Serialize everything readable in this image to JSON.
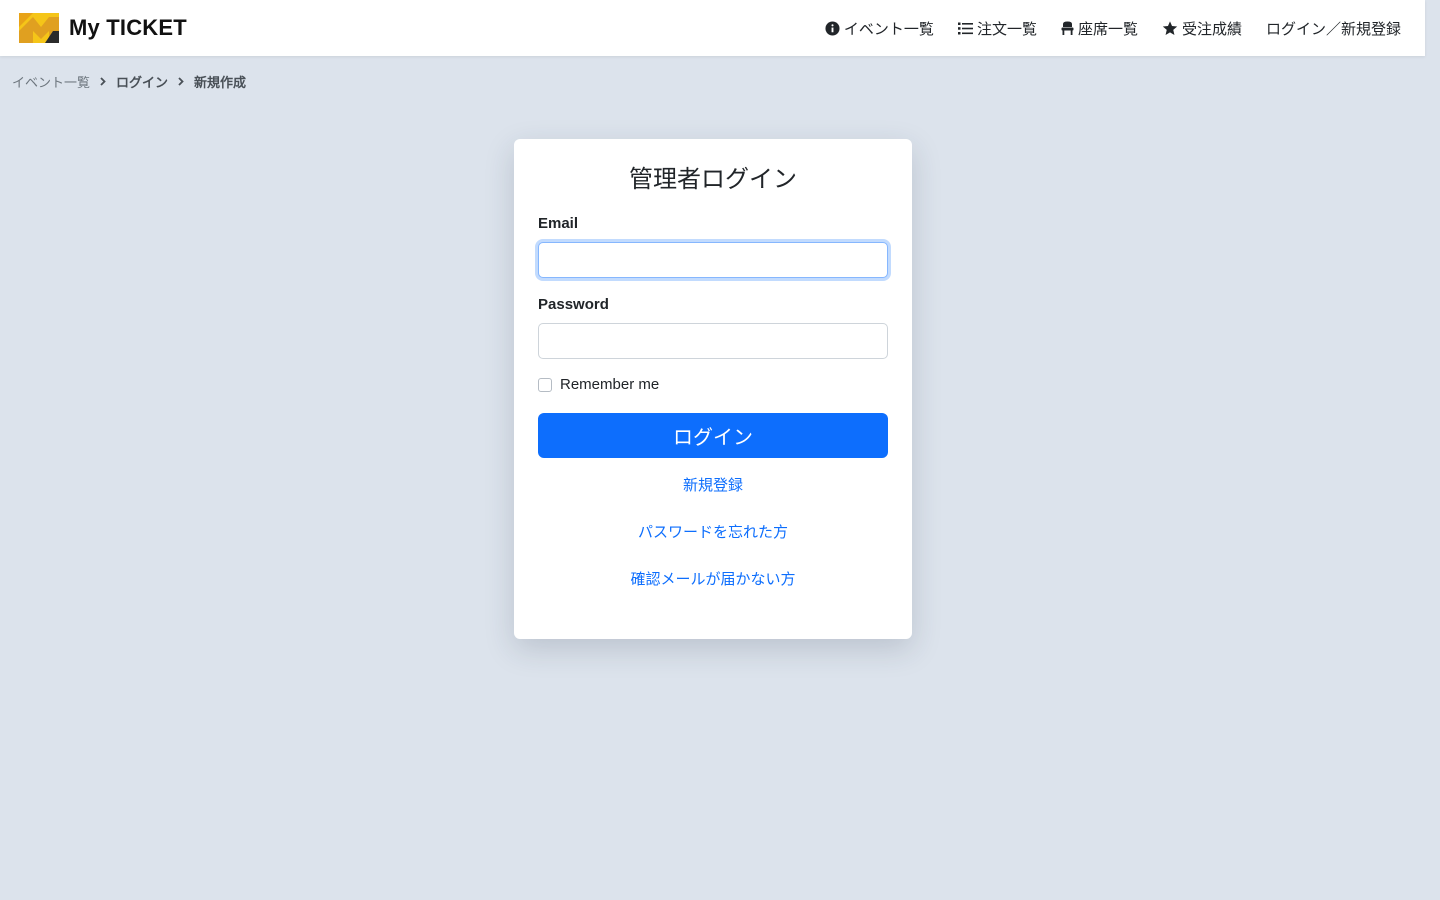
{
  "brand": {
    "name": "My TICKET",
    "logo_icon": "brand-logo-icon",
    "logo_colors": [
      "#f5c518",
      "#e8a317",
      "#2b2b2b"
    ]
  },
  "nav": {
    "items": [
      {
        "label": "イベント一覧",
        "icon": "info-circle-icon"
      },
      {
        "label": "注文一覧",
        "icon": "list-icon"
      },
      {
        "label": "座席一覧",
        "icon": "seat-icon"
      },
      {
        "label": "受注成績",
        "icon": "star-icon"
      },
      {
        "label": "ログイン／新規登録",
        "icon": ""
      }
    ]
  },
  "breadcrumb": {
    "items": [
      "イベント一覧",
      "ログイン",
      "新規作成"
    ]
  },
  "login": {
    "title": "管理者ログイン",
    "email_label": "Email",
    "email_value": "",
    "password_label": "Password",
    "password_value": "",
    "remember_label": "Remember me",
    "remember_checked": false,
    "submit_label": "ログイン",
    "links": {
      "signup": "新規登録",
      "forgot_password": "パスワードを忘れた方",
      "resend_confirmation": "確認メールが届かない方"
    }
  },
  "colors": {
    "background": "#dce3ec",
    "primary": "#0d6efd",
    "card": "#ffffff"
  }
}
